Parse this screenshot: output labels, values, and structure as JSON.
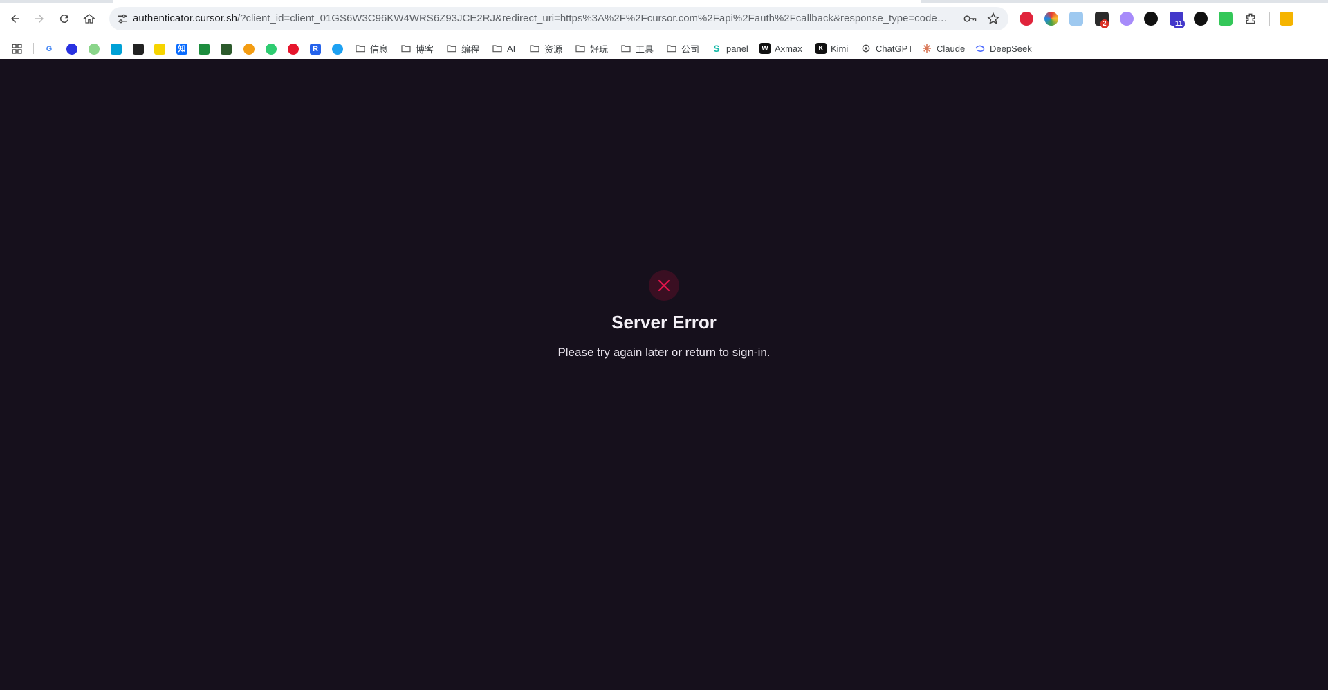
{
  "browser": {
    "url_host": "authenticator.cursor.sh",
    "url_rest": "/?client_id=client_01GS6W3C96KW4WRS6Z93JCE2RJ&redirect_uri=https%3A%2F%2Fcursor.com%2Fapi%2Fauth%2Fcallback&response_type=code&stat...",
    "extension_badges": [
      "2",
      "11"
    ],
    "icons": [
      "back-arrow-icon",
      "forward-arrow-icon",
      "reload-icon",
      "home-icon",
      "site-settings-icon",
      "password-key-icon",
      "star-icon",
      "extensions-puzzle-icon",
      "apps-grid-icon",
      "folder-icon"
    ]
  },
  "bookmarks": {
    "folders": [
      "信息",
      "博客",
      "编程",
      "AI",
      "资源",
      "好玩",
      "工具",
      "公司"
    ],
    "sites": [
      "panel",
      "Axmax",
      "Kimi",
      "ChatGPT",
      "Claude",
      "DeepSeek"
    ],
    "favicon_glyphs": [
      "G",
      "知",
      "R"
    ]
  },
  "page": {
    "title": "Server Error",
    "message": "Please try again later or return to sign-in.",
    "colors": {
      "background": "#16101c",
      "error_accent": "#e0144c",
      "error_circle": "#3a0f22",
      "text": "#f5f1f7"
    }
  }
}
